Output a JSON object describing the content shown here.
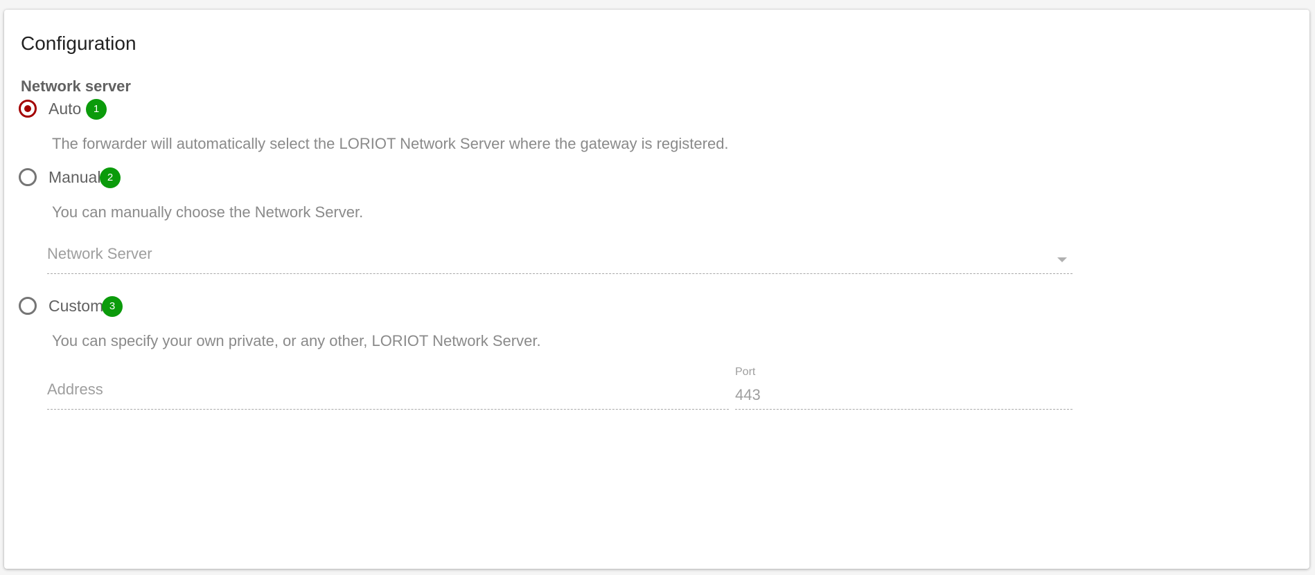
{
  "config": {
    "title": "Configuration",
    "section_title": "Network server",
    "options": [
      {
        "label": "Auto",
        "badge": "1",
        "selected": true,
        "description": "The forwarder will automatically select the LORIOT Network Server where the gateway is registered."
      },
      {
        "label": "Manual",
        "badge": "2",
        "selected": false,
        "description": "You can manually choose the Network Server."
      },
      {
        "label": "Custom",
        "badge": "3",
        "selected": false,
        "description": "You can specify your own private, or any other, LORIOT Network Server."
      }
    ],
    "network_server_select": {
      "placeholder": "Network Server",
      "icon": "chevron-down-icon"
    },
    "address_field": {
      "placeholder": "Address"
    },
    "port_field": {
      "label": "Port",
      "value": "443"
    },
    "colors": {
      "accent": "#a30000",
      "badge": "#0b9b0b",
      "radio_border": "#757575"
    }
  }
}
